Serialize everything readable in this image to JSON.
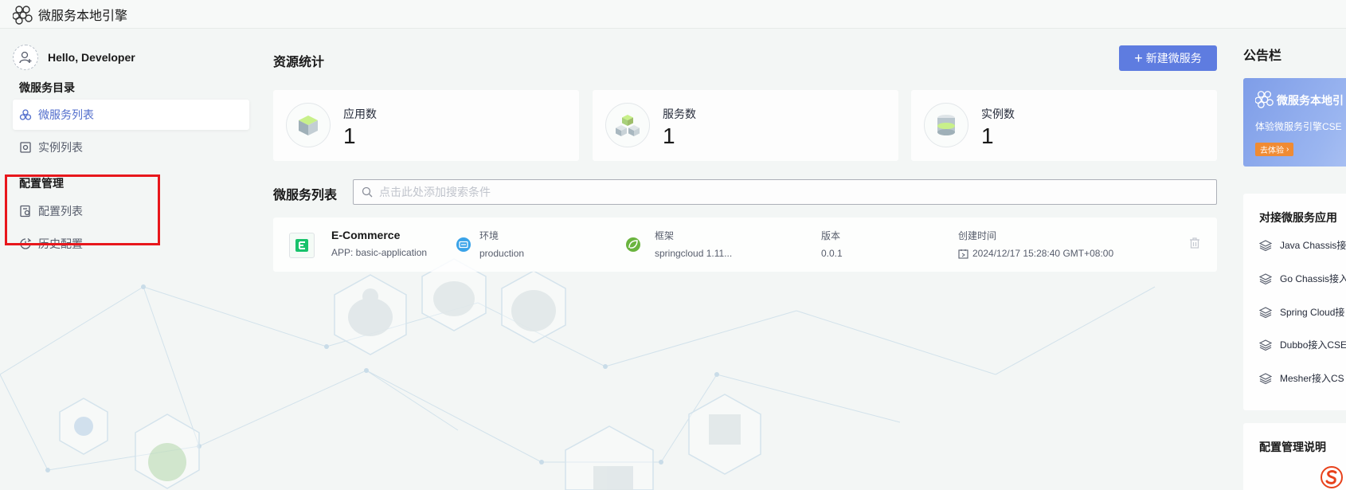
{
  "app": {
    "title": "微服务本地引擎"
  },
  "sidebar": {
    "greeting": "Hello, Developer",
    "sections": [
      {
        "title": "微服务目录",
        "items": [
          {
            "label": "微服务列表",
            "active": true
          },
          {
            "label": "实例列表",
            "active": false
          }
        ]
      },
      {
        "title": "配置管理",
        "items": [
          {
            "label": "配置列表",
            "active": false
          },
          {
            "label": "历史配置",
            "active": false
          }
        ]
      }
    ]
  },
  "main": {
    "resource_title": "资源统计",
    "new_button_label": "新建微服务",
    "stats": [
      {
        "label": "应用数",
        "value": "1",
        "icon": "app-cube-icon"
      },
      {
        "label": "服务数",
        "value": "1",
        "icon": "service-cubes-icon"
      },
      {
        "label": "实例数",
        "value": "1",
        "icon": "instance-database-icon"
      }
    ],
    "list_title": "微服务列表",
    "search_placeholder": "点击此处添加搜索条件",
    "services": [
      {
        "name": "E-Commerce",
        "app": "APP: basic-application",
        "env_label": "环境",
        "env_value": "production",
        "framework_label": "框架",
        "framework_value": "springcloud 1.11...",
        "version_label": "版本",
        "version_value": "0.0.1",
        "created_label": "创建时间",
        "created_value": "2024/12/17 15:28:40 GMT+08:00"
      }
    ]
  },
  "right": {
    "notice_title": "公告栏",
    "banner": {
      "title": "微服务本地引",
      "subtitle": "体验微服务引擎CSE",
      "button": "去体验"
    },
    "dock_title": "对接微服务应用",
    "dock_items": [
      "Java Chassis接",
      "Go Chassis接入",
      "Spring Cloud接",
      "Dubbo接入CSE",
      "Mesher接入CS"
    ],
    "config_title": "配置管理说明"
  },
  "colors": {
    "primary": "#5e7ce0",
    "active_nav": "#526ecc",
    "highlight": "#e8171c",
    "banner_button": "#f08b33"
  }
}
